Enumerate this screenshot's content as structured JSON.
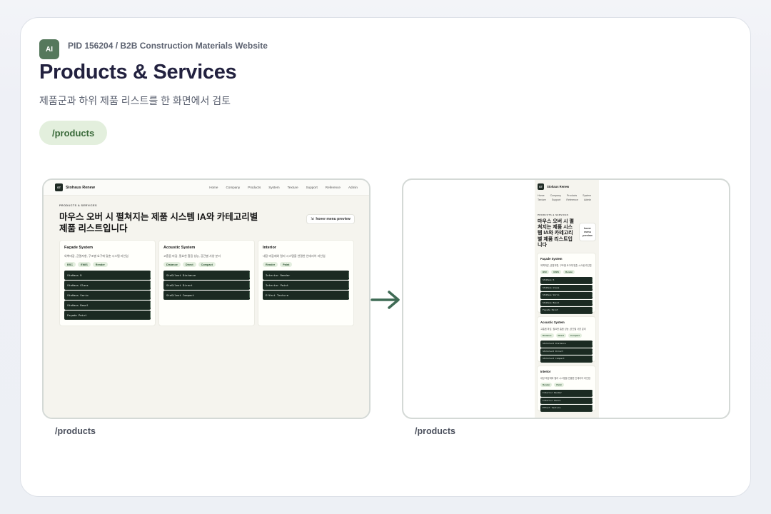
{
  "header": {
    "badge": "AI",
    "pid": "PID 156204 / B2B Construction Materials Website",
    "title": "Products & Services",
    "subtitle": "제품군과 하위 제품 리스트를 한 화면에서 검토",
    "route": "/products"
  },
  "frames": {
    "desktop_label": "/products",
    "mobile_label": "/products"
  },
  "site": {
    "logo": "ST",
    "brand": "Stohaus Renew",
    "nav": [
      "Home",
      "Company",
      "Products",
      "System",
      "Texture",
      "Support",
      "Reference",
      "Admin"
    ],
    "eyebrow": "PRODUCTS & SERVICES",
    "hero_line1": "마우스 오버 시 펼쳐지는 제품 시스템 IA와 카테고리별",
    "hero_line2": "제품 리스트입니다",
    "mobile_hero": [
      "마우스 오버 시 펼",
      "쳐지는 제품 시스",
      "템 IA와 카테고리",
      "별 제품 리스트입",
      "니다"
    ],
    "hover_chip": "hover menu preview",
    "mobile_hover_chip": [
      "hover",
      "menu",
      "preview"
    ],
    "categories": [
      {
        "name": "Façade System",
        "desc": "외벽마감, 균열저항, 구조별 요구에 맞춘 시스템 라인업",
        "tags": [
          "BSC",
          "EWIS",
          "Render"
        ],
        "products": [
          "StoHaus R",
          "StoHaus Glass",
          "StoHaus Vario",
          "StoHaus Basol",
          "Façade Paint"
        ]
      },
      {
        "name": "Acoustic System",
        "desc": "고흡음 마감, 필요한 흡음 성능, 공간별 사양 분리",
        "tags": [
          "Distance",
          "Direct",
          "Compact"
        ],
        "products": [
          "StoSilent Distance",
          "StoSilent Direct",
          "StoSilent Compact"
        ]
      },
      {
        "name": "Interior",
        "desc": "내장 마감재와 컬러 시스템을 연결한 인테리어 라인업",
        "tags": [
          "Render",
          "Paint"
        ],
        "products": [
          "Interior Render",
          "Interior Paint",
          "Effect Texture"
        ]
      }
    ]
  }
}
